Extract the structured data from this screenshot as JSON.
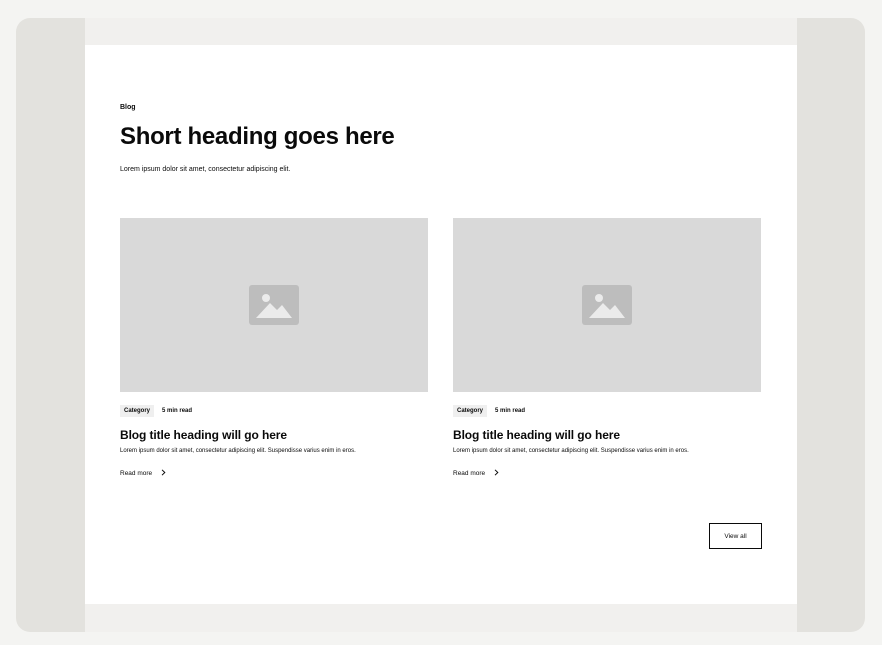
{
  "header": {
    "tagline": "Blog",
    "heading": "Short heading goes here",
    "description": "Lorem ipsum dolor sit amet, consectetur adipiscing elit."
  },
  "posts": [
    {
      "image_icon": "image-placeholder-icon",
      "category": "Category",
      "read_time": "5 min read",
      "title": "Blog title heading will go here",
      "description": "Lorem ipsum dolor sit amet, consectetur adipiscing elit. Suspendisse varius enim in eros.",
      "read_more": "Read more"
    },
    {
      "image_icon": "image-placeholder-icon",
      "category": "Category",
      "read_time": "5 min read",
      "title": "Blog title heading will go here",
      "description": "Lorem ipsum dolor sit amet, consectetur adipiscing elit. Suspendisse varius enim in eros.",
      "read_more": "Read more"
    }
  ],
  "actions": {
    "view_all": "View all"
  },
  "colors": {
    "frame": "#e3e2de",
    "canvas": "#f1f0ee",
    "section": "#ffffff",
    "placeholder": "#d9d9d9",
    "badge": "#efefef",
    "text": "#0a0a0a"
  }
}
